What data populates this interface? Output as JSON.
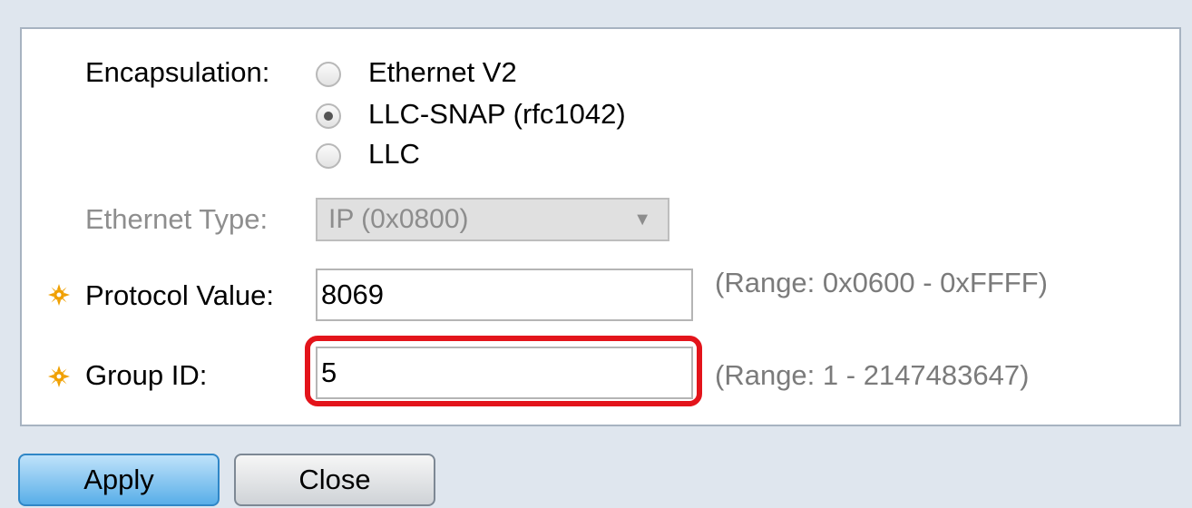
{
  "form": {
    "encapsulation_label": "Encapsulation:",
    "encapsulation_options": [
      {
        "label": "Ethernet V2",
        "selected": false
      },
      {
        "label": "LLC-SNAP (rfc1042)",
        "selected": true
      },
      {
        "label": "LLC",
        "selected": false
      }
    ],
    "ethernet_type_label": "Ethernet Type:",
    "ethernet_type_value": "IP (0x0800)",
    "protocol_value_label": "Protocol Value:",
    "protocol_value": "8069",
    "protocol_range": "(Range: 0x0600 - 0xFFFF)",
    "group_id_label": "Group ID:",
    "group_id": "5",
    "group_id_range": "(Range: 1 - 2147483647)"
  },
  "buttons": {
    "apply": "Apply",
    "close": "Close"
  },
  "colors": {
    "required_star": "#f0a000",
    "highlight": "#e3141b",
    "apply_button": "#58aee8"
  }
}
